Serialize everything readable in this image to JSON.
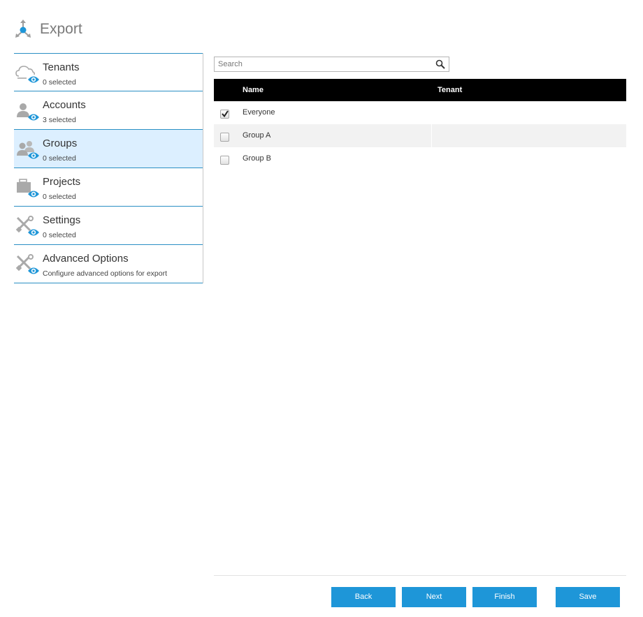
{
  "header": {
    "title": "Export",
    "icon": "export-icon"
  },
  "sidebar": {
    "items": [
      {
        "label": "Tenants",
        "sub": "0 selected",
        "icon": "tenants-icon",
        "active": false
      },
      {
        "label": "Accounts",
        "sub": "3 selected",
        "icon": "accounts-icon",
        "active": false
      },
      {
        "label": "Groups",
        "sub": "0 selected",
        "icon": "groups-icon",
        "active": true
      },
      {
        "label": "Projects",
        "sub": "0 selected",
        "icon": "projects-icon",
        "active": false
      },
      {
        "label": "Settings",
        "sub": "0 selected",
        "icon": "settings-icon",
        "active": false
      },
      {
        "label": "Advanced Options",
        "sub": "Configure advanced options for export",
        "icon": "advanced-options-icon",
        "active": false
      }
    ]
  },
  "search": {
    "placeholder": "Search",
    "value": ""
  },
  "grid": {
    "columns": [
      "Name",
      "Tenant"
    ],
    "rows": [
      {
        "name": "Everyone",
        "tenant": "",
        "checked": true
      },
      {
        "name": "Group A",
        "tenant": "",
        "checked": false
      },
      {
        "name": "Group B",
        "tenant": "",
        "checked": false
      }
    ]
  },
  "buttons": {
    "back": "Back",
    "next": "Next",
    "finish": "Finish",
    "save": "Save"
  },
  "colors": {
    "accent": "#1e96d8",
    "active_bg": "#dcefff",
    "divider": "#2a8fc4",
    "eye": "#1e96d8",
    "icon_gray": "#a9a9a9"
  }
}
